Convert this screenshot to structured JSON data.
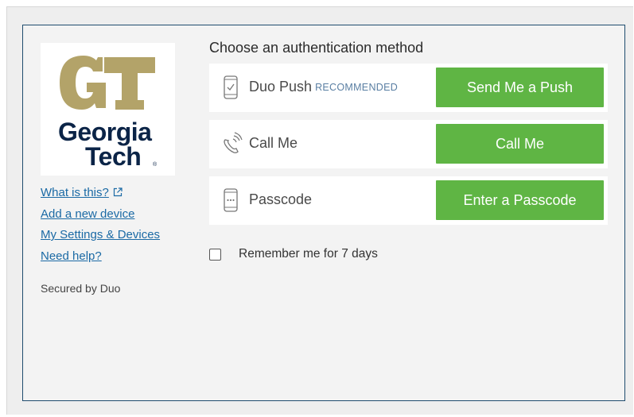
{
  "brand": {
    "monogram": "GT",
    "name_line1": "Georgia",
    "name_line2": "Tech",
    "trademark": "®",
    "colors": {
      "gold": "#b3a369",
      "navy": "#0b2447"
    }
  },
  "sidebar": {
    "links": [
      {
        "label": "What is this?",
        "icon": "external-link-icon"
      },
      {
        "label": "Add a new device"
      },
      {
        "label": "My Settings & Devices"
      },
      {
        "label": "Need help?"
      }
    ],
    "secured_by": "Secured by Duo"
  },
  "prompt": {
    "heading": "Choose an authentication method",
    "methods": [
      {
        "label": "Duo Push",
        "badge": "RECOMMENDED",
        "icon": "phone-check-icon",
        "button": "Send Me a Push"
      },
      {
        "label": "Call Me",
        "icon": "phone-call-icon",
        "button": "Call Me"
      },
      {
        "label": "Passcode",
        "icon": "passcode-device-icon",
        "button": "Enter a Passcode"
      }
    ],
    "remember_label": "Remember me for 7 days",
    "remember_checked": false
  },
  "colors": {
    "button_green": "#5fb544",
    "link_blue": "#1b6aa5",
    "frame_border": "#1f4c6e"
  }
}
